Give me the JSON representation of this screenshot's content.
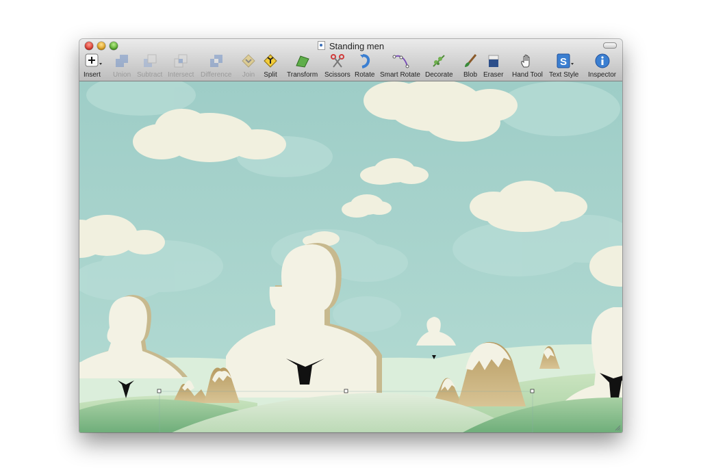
{
  "window": {
    "title": "Standing men",
    "colors": {
      "sky": "#a7d3cd",
      "figure": "#f3f2e4",
      "tie": "#111111",
      "hill_light": "#cfe6c7",
      "hill_dark": "#8fbf8f",
      "mountain": "#c4a873"
    }
  },
  "toolbar": {
    "items": [
      {
        "label": "Insert",
        "icon": "plus-icon",
        "enabled": true
      },
      {
        "label": "Union",
        "icon": "union-icon",
        "enabled": false
      },
      {
        "label": "Subtract",
        "icon": "subtract-icon",
        "enabled": false
      },
      {
        "label": "Intersect",
        "icon": "intersect-icon",
        "enabled": false
      },
      {
        "label": "Difference",
        "icon": "difference-icon",
        "enabled": false
      },
      {
        "label": "Join",
        "icon": "join-icon",
        "enabled": false
      },
      {
        "label": "Split",
        "icon": "split-icon",
        "enabled": true
      },
      {
        "label": "Transform",
        "icon": "transform-icon",
        "enabled": true
      },
      {
        "label": "Scissors",
        "icon": "scissors-icon",
        "enabled": true
      },
      {
        "label": "Rotate",
        "icon": "rotate-icon",
        "enabled": true
      },
      {
        "label": "Smart Rotate",
        "icon": "smart-rotate-icon",
        "enabled": true
      },
      {
        "label": "Decorate",
        "icon": "decorate-icon",
        "enabled": true
      },
      {
        "label": "Blob",
        "icon": "blob-brush-icon",
        "enabled": true
      },
      {
        "label": "Eraser",
        "icon": "eraser-icon",
        "enabled": true
      },
      {
        "label": "Hand Tool",
        "icon": "hand-icon",
        "enabled": true
      },
      {
        "label": "Text Style",
        "icon": "text-style-icon",
        "enabled": true
      },
      {
        "label": "Inspector",
        "icon": "info-icon",
        "enabled": true
      }
    ]
  }
}
